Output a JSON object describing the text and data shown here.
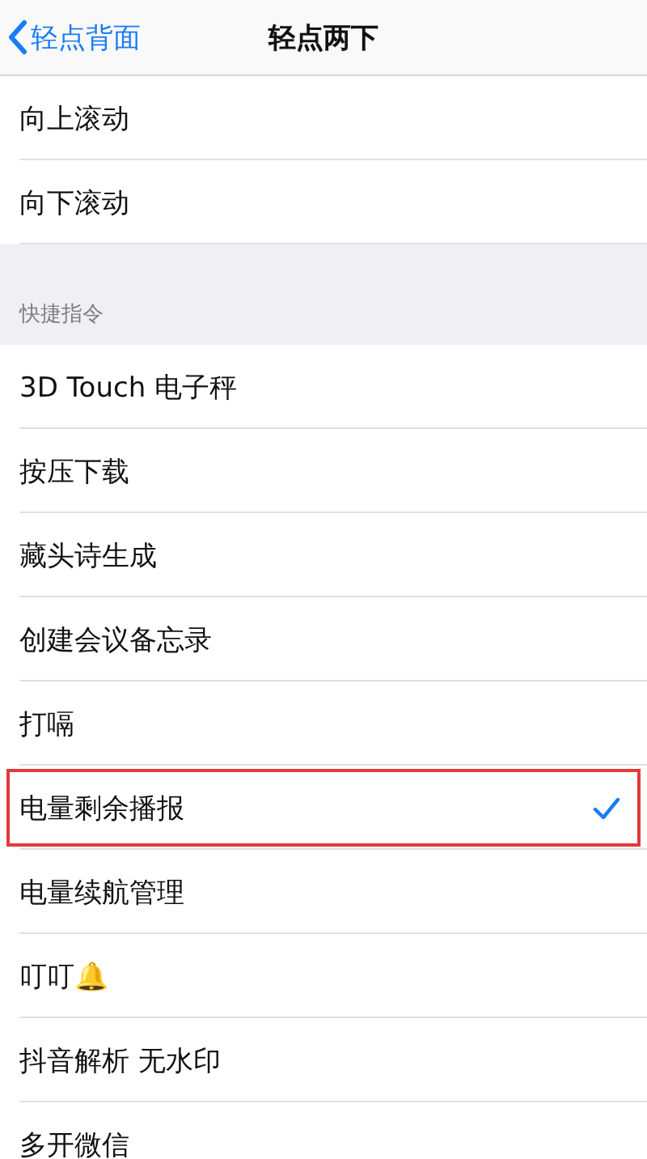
{
  "nav": {
    "back": "轻点背面",
    "title": "轻点两下"
  },
  "sections": [
    {
      "items": [
        {
          "label": "向上滚动",
          "selected": false,
          "highlighted": false
        },
        {
          "label": "向下滚动",
          "selected": false,
          "highlighted": false
        }
      ]
    },
    {
      "header": "快捷指令",
      "items": [
        {
          "label": "3D Touch 电子秤",
          "selected": false,
          "highlighted": false
        },
        {
          "label": "按压下载",
          "selected": false,
          "highlighted": false
        },
        {
          "label": "藏头诗生成",
          "selected": false,
          "highlighted": false
        },
        {
          "label": "创建会议备忘录",
          "selected": false,
          "highlighted": false
        },
        {
          "label": "打嗝",
          "selected": false,
          "highlighted": false
        },
        {
          "label": "电量剩余播报",
          "selected": true,
          "highlighted": true
        },
        {
          "label": "电量续航管理",
          "selected": false,
          "highlighted": false
        },
        {
          "label": "叮叮🔔",
          "selected": false,
          "highlighted": false
        },
        {
          "label": "抖音解析 无水印",
          "selected": false,
          "highlighted": false
        },
        {
          "label": "多开微信",
          "selected": false,
          "highlighted": false
        }
      ]
    }
  ]
}
